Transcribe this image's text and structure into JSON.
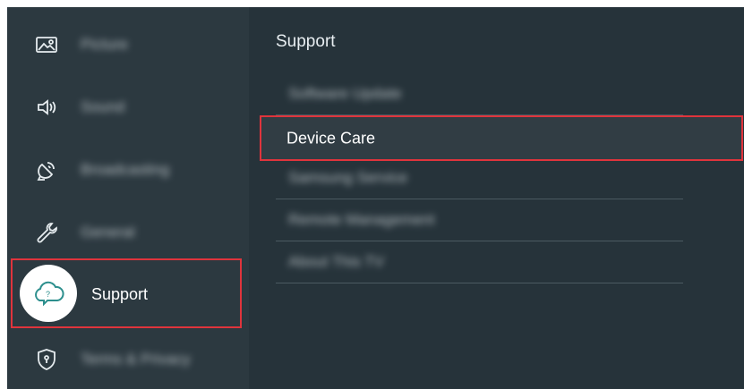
{
  "sidebar": {
    "items": [
      {
        "label": "Picture",
        "icon": "picture-icon"
      },
      {
        "label": "Sound",
        "icon": "sound-icon"
      },
      {
        "label": "Broadcasting",
        "icon": "broadcasting-icon"
      },
      {
        "label": "General",
        "icon": "wrench-icon"
      },
      {
        "label": "Support",
        "icon": "support-cloud-icon",
        "selected": true
      },
      {
        "label": "Terms & Privacy",
        "icon": "shield-icon"
      }
    ]
  },
  "panel": {
    "title": "Support",
    "items": [
      {
        "label": "Software Update"
      },
      {
        "label": "Device Care",
        "highlighted": true
      },
      {
        "label": "Samsung Service"
      },
      {
        "label": "Remote Management"
      },
      {
        "label": "About This TV"
      }
    ]
  },
  "colors": {
    "background": "#26333a",
    "sidebar": "#2c3940",
    "highlight_border": "#e0343c"
  }
}
